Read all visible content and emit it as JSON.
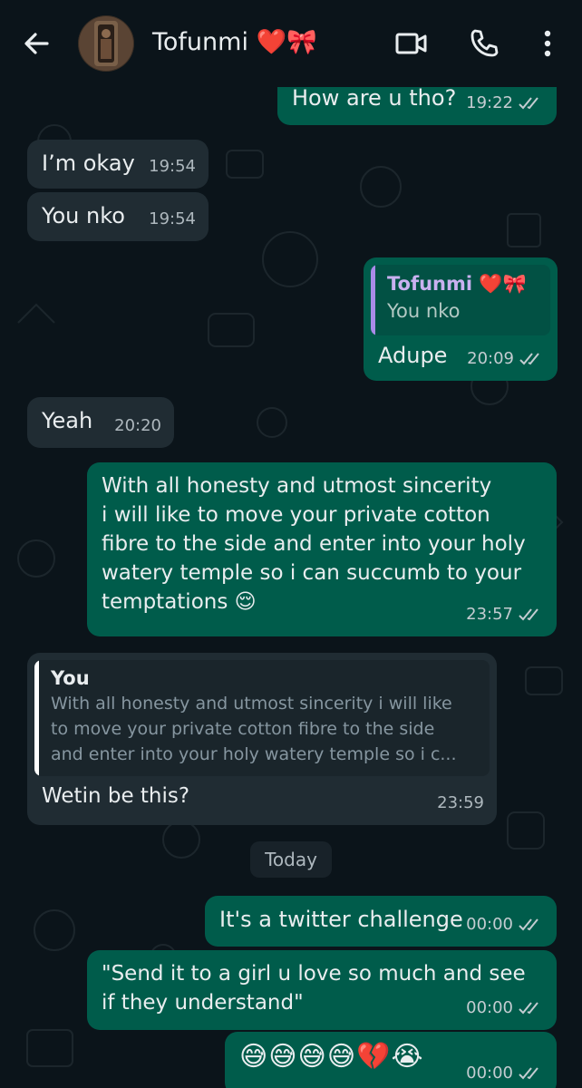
{
  "header": {
    "contact_name": "Tofunmi",
    "contact_emojis": "❤️🎀"
  },
  "messages": [
    {
      "id": "m1",
      "dir": "out",
      "text": "How are u tho?",
      "time": "19:22"
    },
    {
      "id": "m2",
      "dir": "in",
      "text": "I’m okay",
      "time": "19:54"
    },
    {
      "id": "m3",
      "dir": "in",
      "text": "You nko",
      "time": "19:54"
    },
    {
      "id": "m4",
      "dir": "out",
      "quote_author": "Tofunmi ❤️🎀",
      "quote_text": "You nko",
      "text": "Adupe",
      "time": "20:09"
    },
    {
      "id": "m5",
      "dir": "in",
      "text": "Yeah",
      "time": "20:20"
    },
    {
      "id": "m6",
      "dir": "out",
      "lines": [
        "With all honesty and utmost sincerity",
        "i will like to move your private cotton",
        "fibre to the side and enter into your holy",
        "watery temple so i can succumb to your",
        "temptations 😌"
      ],
      "time": "23:57"
    },
    {
      "id": "m7",
      "dir": "in",
      "quote_author": "You",
      "quote_lines": [
        "With all honesty and utmost sincerity i will like",
        "to move your private cotton fibre to the side",
        "and enter into your holy watery temple so i c..."
      ],
      "text": "Wetin be this?",
      "time": "23:59"
    },
    {
      "id": "m8",
      "dir": "out",
      "text": "It's a twitter challenge",
      "time": "00:00"
    },
    {
      "id": "m9",
      "dir": "out",
      "lines": [
        "\"Send it to a girl u love so much and see",
        "if they understand\""
      ],
      "time": "00:00"
    },
    {
      "id": "m10",
      "dir": "out",
      "emojis": "😅😅😅😅💔😭",
      "time": "00:00"
    }
  ],
  "date_separator": "Today",
  "colors": {
    "background": "#0b141a",
    "incoming_bubble": "#202c33",
    "outgoing_bubble": "#005c4b",
    "quote_bar_contact": "#a98be8",
    "quote_bar_self": "#ffffff"
  },
  "icons": [
    "back-arrow-icon",
    "video-call-icon",
    "voice-call-icon",
    "more-options-icon",
    "double-check-icon"
  ]
}
